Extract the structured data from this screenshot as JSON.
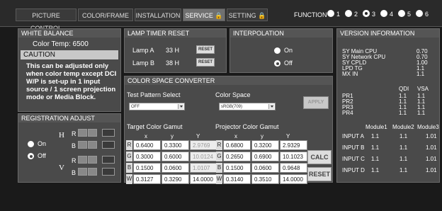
{
  "tabs": [
    {
      "label": "PICTURE CONTROL",
      "active": false
    },
    {
      "label": "COLOR/FRAME",
      "active": false
    },
    {
      "label": "INSTALLATION",
      "active": false
    },
    {
      "label": "SERVICE 🔒",
      "active": true
    },
    {
      "label": "SETTING 🔒",
      "active": false
    }
  ],
  "function": {
    "label": "FUNCTION",
    "items": [
      {
        "label": "1",
        "selected": false
      },
      {
        "label": "2",
        "selected": false
      },
      {
        "label": "3",
        "selected": true
      },
      {
        "label": "4",
        "selected": false
      },
      {
        "label": "5",
        "selected": false
      },
      {
        "label": "6",
        "selected": false
      }
    ]
  },
  "white_balance": {
    "title": "WHITE BALANCE",
    "color_temp": "Color Temp: 6500",
    "caution_title": "CAUTION",
    "caution_text": "This can be adjusted only when color temp except DCI W/P is set-up in 1 input source / 1 screen projection mode or Media Block."
  },
  "registration": {
    "title": "REGISTRATION ADJUST",
    "on_label": "On",
    "off_label": "Off",
    "h_label": "H",
    "v_label": "V",
    "r_label": "R",
    "b_label": "B"
  },
  "lamp_timer": {
    "title": "LAMP TIMER RESET",
    "lamp_a_label": "Lamp A",
    "lamp_a_hours": "33 H",
    "lamp_b_label": "Lamp B",
    "lamp_b_hours": "38 H",
    "reset_label": "RESET"
  },
  "interpolation": {
    "title": "INTERPOLATION",
    "on_label": "On",
    "off_label": "Off",
    "selected": "Off"
  },
  "color_space": {
    "title": "COLOR SPACE CONVERTER",
    "test_pattern_label": "Test Pattern Select",
    "test_pattern_value": "OFF",
    "color_space_label": "Color Space",
    "color_space_value": "sRGB(709)",
    "apply_label": "APPLY",
    "target_title": "Target Color Gamut",
    "projector_title": "Projector Color Gamut",
    "col_x": "x",
    "col_y": "y",
    "col_Y": "Y",
    "rows": [
      "R",
      "G",
      "B",
      "W"
    ],
    "target": [
      [
        "0.6400",
        "0.3300",
        "2.9769"
      ],
      [
        "0.3000",
        "0.6000",
        "10.0124"
      ],
      [
        "0.1500",
        "0.0600",
        "1.0107"
      ],
      [
        "0.3127",
        "0.3290",
        "14.0000"
      ]
    ],
    "projector": [
      [
        "0.6800",
        "0.3200",
        "2.9329"
      ],
      [
        "0.2650",
        "0.6900",
        "10.1023"
      ],
      [
        "0.1500",
        "0.0600",
        "0.9648"
      ],
      [
        "0.3140",
        "0.3510",
        "14.0000"
      ]
    ],
    "calc_label": "CALC",
    "reset_label": "RESET"
  },
  "version": {
    "title": "VERSION INFORMATION",
    "items": [
      {
        "label": "SY Main CPU",
        "value": "0.70"
      },
      {
        "label": "SY Network CPU",
        "value": "0.70"
      },
      {
        "label": "SY CPLD",
        "value": "1.00"
      },
      {
        "label": "LPD TG",
        "value": "1.1"
      },
      {
        "label": "MX IN",
        "value": "1.1"
      }
    ],
    "pr_headers": [
      "QDI",
      "VSA"
    ],
    "pr_rows": [
      {
        "label": "PR1",
        "qdi": "1.1",
        "vsa": "1.1"
      },
      {
        "label": "PR2",
        "qdi": "1.1",
        "vsa": "1.1"
      },
      {
        "label": "PR3",
        "qdi": "1.1",
        "vsa": "1.1"
      },
      {
        "label": "PR4",
        "qdi": "1.1",
        "vsa": "1.1"
      }
    ],
    "module_headers": [
      "Module1",
      "Module2",
      "Module3"
    ],
    "inputs": [
      {
        "label": "INPUT A",
        "m1": "1.1",
        "m2": "1.1",
        "m3": "1.01"
      },
      {
        "label": "INPUT B",
        "m1": "1.1",
        "m2": "1.1",
        "m3": "1.01"
      },
      {
        "label": "INPUT C",
        "m1": "1.1",
        "m2": "1.1",
        "m3": "1.01"
      },
      {
        "label": "INPUT D",
        "m1": "1.1",
        "m2": "1.1",
        "m3": "1.01"
      }
    ]
  }
}
